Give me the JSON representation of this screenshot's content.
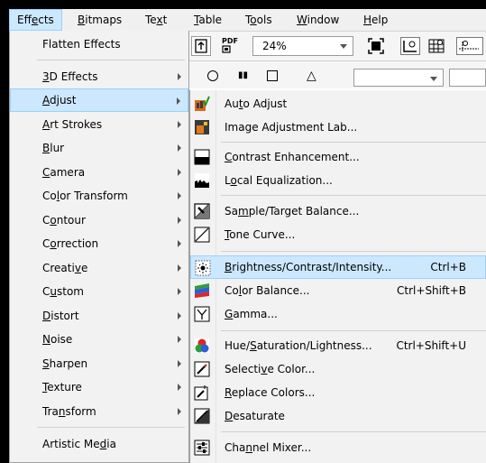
{
  "menubar": {
    "items": [
      {
        "pre": "Eff",
        "u": "e",
        "post": "cts",
        "id": "effects"
      },
      {
        "pre": "",
        "u": "B",
        "post": "itmaps",
        "id": "bitmaps"
      },
      {
        "pre": "Te",
        "u": "x",
        "post": "t",
        "id": "text"
      },
      {
        "pre": "",
        "u": "T",
        "post": "able",
        "id": "table"
      },
      {
        "pre": "T",
        "u": "o",
        "post": "ols",
        "id": "tools"
      },
      {
        "pre": "",
        "u": "W",
        "post": "indow",
        "id": "window"
      },
      {
        "pre": "",
        "u": "H",
        "post": "elp",
        "id": "help"
      }
    ]
  },
  "toolbar": {
    "pdf_label": "PDF",
    "zoom_value": "24%"
  },
  "effects_menu": {
    "items": [
      {
        "pre": "Flatten Effects",
        "u": "",
        "post": ""
      },
      {
        "pre": "",
        "u": "3",
        "post": "D Effects"
      },
      {
        "pre": "",
        "u": "A",
        "post": "djust"
      },
      {
        "pre": "",
        "u": "A",
        "post": "rt Strokes"
      },
      {
        "pre": "",
        "u": "B",
        "post": "lur"
      },
      {
        "pre": "",
        "u": "C",
        "post": "amera"
      },
      {
        "pre": "Co",
        "u": "l",
        "post": "or Transform"
      },
      {
        "pre": "C",
        "u": "o",
        "post": "ntour"
      },
      {
        "pre": "C",
        "u": "o",
        "post": "rrection"
      },
      {
        "pre": "Creati",
        "u": "v",
        "post": "e"
      },
      {
        "pre": "C",
        "u": "u",
        "post": "stom"
      },
      {
        "pre": "",
        "u": "D",
        "post": "istort"
      },
      {
        "pre": "",
        "u": "N",
        "post": "oise"
      },
      {
        "pre": "",
        "u": "S",
        "post": "harpen"
      },
      {
        "pre": "",
        "u": "T",
        "post": "exture"
      },
      {
        "pre": "Tra",
        "u": "n",
        "post": "sform"
      },
      {
        "pre": "Artistic Me",
        "u": "d",
        "post": "ia"
      }
    ]
  },
  "adjust_menu": {
    "items": [
      {
        "pre": "Au",
        "u": "t",
        "post": "o Adjust",
        "shortcut": ""
      },
      {
        "pre": "Image Adjustment Lab...",
        "u": "",
        "post": "",
        "shortcut": ""
      },
      {
        "pre": "",
        "u": "C",
        "post": "ontrast Enhancement...",
        "shortcut": ""
      },
      {
        "pre": "L",
        "u": "o",
        "post": "cal Equalization...",
        "shortcut": ""
      },
      {
        "pre": "Sa",
        "u": "m",
        "post": "ple/Target Balance...",
        "shortcut": ""
      },
      {
        "pre": "",
        "u": "T",
        "post": "one Curve...",
        "shortcut": ""
      },
      {
        "pre": "",
        "u": "B",
        "post": "rightness/Contrast/Intensity...",
        "shortcut": "Ctrl+B"
      },
      {
        "pre": "Co",
        "u": "l",
        "post": "or Balance...",
        "shortcut": "Ctrl+Shift+B"
      },
      {
        "pre": "",
        "u": "G",
        "post": "amma...",
        "shortcut": ""
      },
      {
        "pre": "Hue/",
        "u": "S",
        "post": "aturation/Lightness...",
        "shortcut": "Ctrl+Shift+U"
      },
      {
        "pre": "Selecti",
        "u": "v",
        "post": "e Color...",
        "shortcut": ""
      },
      {
        "pre": "",
        "u": "R",
        "post": "eplace Colors...",
        "shortcut": ""
      },
      {
        "pre": "",
        "u": "D",
        "post": "esaturate",
        "shortcut": ""
      },
      {
        "pre": "Cha",
        "u": "n",
        "post": "nel Mixer...",
        "shortcut": ""
      }
    ]
  }
}
